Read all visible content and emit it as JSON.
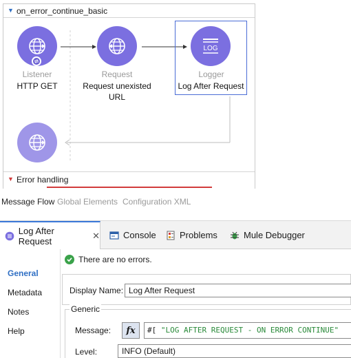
{
  "flow": {
    "name": "on_error_continue_basic",
    "nodes": [
      {
        "type": "Listener",
        "name": "HTTP GET"
      },
      {
        "type": "Request",
        "name": "Request unexisted URL"
      },
      {
        "type": "Logger",
        "name": "Log After Request",
        "icon_text": "LOG"
      }
    ],
    "error_handling_label": "Error handling"
  },
  "view_tabs": [
    "Message Flow",
    "Global Elements",
    "Configuration XML"
  ],
  "editor_tabs": [
    {
      "label": "Log After Request",
      "icon": "logger-icon",
      "active": true,
      "closable": true
    },
    {
      "label": "Console",
      "icon": "console-icon"
    },
    {
      "label": "Problems",
      "icon": "problems-icon"
    },
    {
      "label": "Mule Debugger",
      "icon": "debugger-icon"
    }
  ],
  "sidenav": [
    "General",
    "Metadata",
    "Notes",
    "Help"
  ],
  "status": "There are no errors.",
  "form": {
    "display_name_label": "Display Name:",
    "display_name_value": "Log After Request",
    "group_label": "Generic",
    "message_label": "Message:",
    "fx_label": "fx",
    "message_prefix": "#[",
    "message_value": "\"LOG AFTER REQUEST - ON ERROR CONTINUE\"",
    "level_label": "Level:",
    "level_value": "INFO (Default)"
  },
  "colors": {
    "node": "#7b6fe0",
    "accent": "#2f6fc4",
    "error": "#d23b3b",
    "ok": "#3aa24a"
  }
}
